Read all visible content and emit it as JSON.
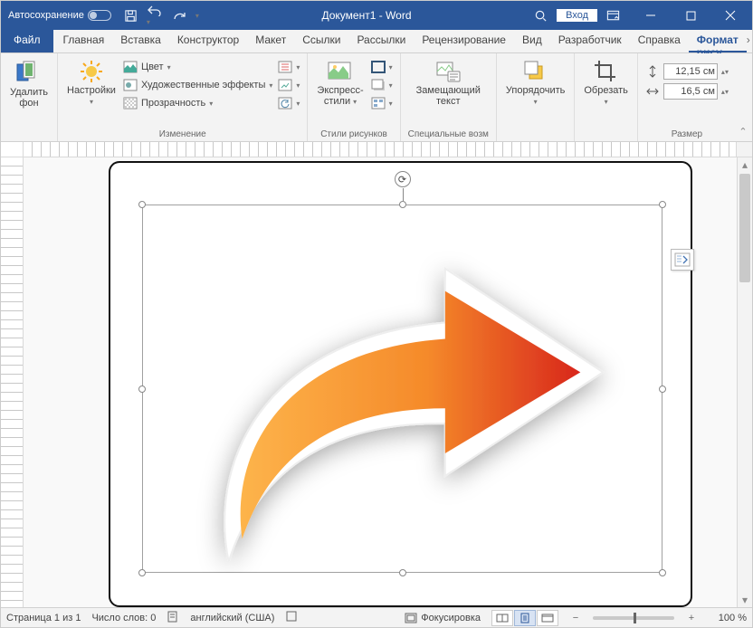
{
  "titlebar": {
    "autosave": "Автосохранение",
    "doc_title": "Документ1 - Word",
    "login": "Вход"
  },
  "tabs": {
    "file": "Файл",
    "items": [
      "Главная",
      "Вставка",
      "Конструктор",
      "Макет",
      "Ссылки",
      "Рассылки",
      "Рецензирование",
      "Вид",
      "Разработчик",
      "Справка"
    ],
    "active": "Формат рису"
  },
  "ribbon": {
    "remove_bg": "Удалить\nфон",
    "adjust": {
      "corrections": "Настройки",
      "color": "Цвет",
      "artistic": "Художественные эффекты",
      "transparency": "Прозрачность",
      "group": "Изменение"
    },
    "styles": {
      "main": "Экспресс-\nстили",
      "group": "Стили рисунков"
    },
    "alt_text": {
      "main": "Замещающий\nтекст",
      "group": "Специальные возм"
    },
    "arrange": {
      "main": "Упорядочить",
      "group": ""
    },
    "crop": {
      "main": "Обрезать"
    },
    "size": {
      "width": "12,15 см",
      "height": "16,5 см",
      "group": "Размер"
    }
  },
  "status": {
    "page": "Страница 1 из 1",
    "words": "Число слов: 0",
    "lang": "английский (США)",
    "focus": "Фокусировка",
    "zoom": "100 %"
  }
}
